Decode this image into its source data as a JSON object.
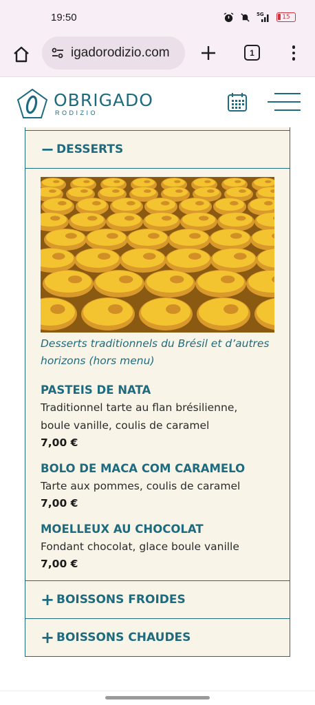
{
  "status_bar": {
    "time": "19:50",
    "network": "5G",
    "battery": "15",
    "icons": [
      "alarm-icon",
      "mute-icon",
      "signal-icon",
      "battery-icon"
    ]
  },
  "browser": {
    "url": "igadorodizio.com",
    "tab_count": "1",
    "icons": [
      "home-icon",
      "site-settings-icon",
      "new-tab-icon",
      "tabs-icon",
      "overflow-menu-icon"
    ]
  },
  "site": {
    "logo_name": "OBRIGADO",
    "logo_sub": "RODIZIO",
    "brand_color": "#1e6b80",
    "icons": [
      "calendar-icon",
      "hamburger-menu-icon"
    ]
  },
  "menu": {
    "open_section": {
      "sign": "−",
      "title": "DESSERTS",
      "caption": "Desserts traditionnels du Brésil et d’autres horizons (hors menu)",
      "items": [
        {
          "name": "PASTEIS DE NATA",
          "desc_lines": [
            "Traditionnel tarte au flan brésilienne,",
            "boule vanille, coulis de caramel"
          ],
          "price": "7,00 €"
        },
        {
          "name": "BOLO DE MACA COM CARAMELO",
          "desc_lines": [
            "Tarte aux pommes, coulis de caramel"
          ],
          "price": "7,00 €"
        },
        {
          "name": "MOELLEUX AU CHOCOLAT",
          "desc_lines": [
            "Fondant chocolat, glace boule vanille"
          ],
          "price": "7,00 €"
        }
      ]
    },
    "collapsed_sections": [
      {
        "sign": "+",
        "title": "BOISSONS FROIDES"
      },
      {
        "sign": "+",
        "title": "BOISSONS CHAUDES"
      }
    ]
  }
}
